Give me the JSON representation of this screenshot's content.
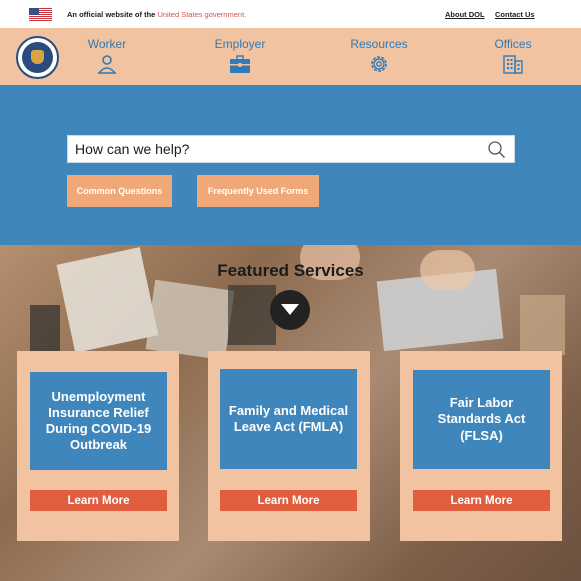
{
  "gov_banner": {
    "text_prefix": "An official website of the ",
    "text_highlight": "United States government.",
    "about_link": "About DOL",
    "contact_link": "Contact Us"
  },
  "nav": {
    "items": [
      {
        "label": "Worker",
        "icon": "person-icon"
      },
      {
        "label": "Employer",
        "icon": "briefcase-icon"
      },
      {
        "label": "Resources",
        "icon": "gear-icon"
      },
      {
        "label": "Offices",
        "icon": "building-icon"
      }
    ]
  },
  "search": {
    "placeholder": "How can we help?"
  },
  "quick_buttons": {
    "common_questions": "Common Questions",
    "frequently_used_forms": "Frequently Used Forms"
  },
  "featured": {
    "title": "Featured Services",
    "cards": [
      {
        "title": "Unemployment Insurance Relief During COVID-19 Outbreak",
        "button": "Learn More"
      },
      {
        "title": "Family and Medical Leave Act (FMLA)",
        "button": "Learn More"
      },
      {
        "title": "Fair Labor Standards Act (FLSA)",
        "button": "Learn More"
      }
    ]
  },
  "colors": {
    "nav_background": "#f2c3a0",
    "hero_blue": "#3f86bd",
    "accent_orange": "#f0a878",
    "learn_more_red": "#e05d3d",
    "nav_text_blue": "#2f7ab8"
  }
}
